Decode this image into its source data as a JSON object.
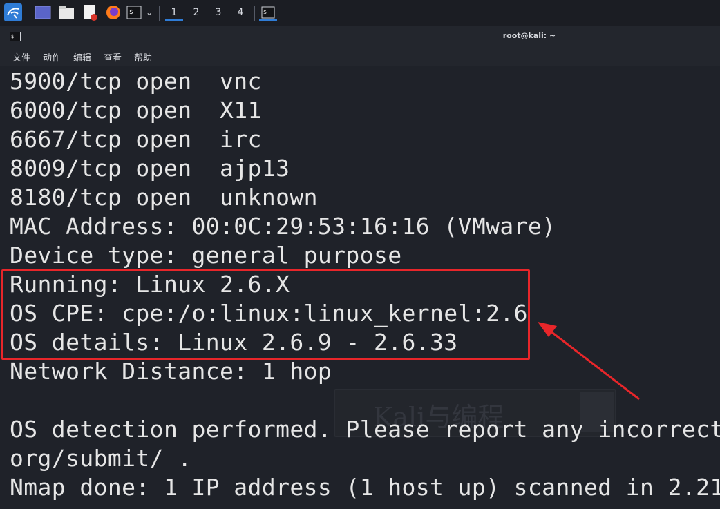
{
  "taskbar": {
    "workspaces": [
      "1",
      "2",
      "3",
      "4"
    ],
    "icons": [
      "kali-menu-icon",
      "show-desktop-icon",
      "file-manager-icon",
      "text-editor-icon",
      "firefox-icon",
      "terminal-icon"
    ]
  },
  "window": {
    "title": "root@kali: ~"
  },
  "menu": {
    "items": [
      "文件",
      "动作",
      "编辑",
      "查看",
      "帮助"
    ]
  },
  "terminal": {
    "lines": [
      "5900/tcp open  vnc",
      "6000/tcp open  X11",
      "6667/tcp open  irc",
      "8009/tcp open  ajp13",
      "8180/tcp open  unknown",
      "MAC Address: 00:0C:29:53:16:16 (VMware)",
      "Device type: general purpose",
      "Running: Linux 2.6.X",
      "OS CPE: cpe:/o:linux:linux_kernel:2.6",
      "OS details: Linux 2.6.9 - 2.6.33",
      "Network Distance: 1 hop",
      "",
      "OS detection performed. Please report any incorrect",
      "org/submit/ .",
      "Nmap done: 1 IP address (1 host up) scanned in 2.21"
    ],
    "watermark": "Kali与编程"
  },
  "annotation": {
    "color": "#e8262a"
  }
}
